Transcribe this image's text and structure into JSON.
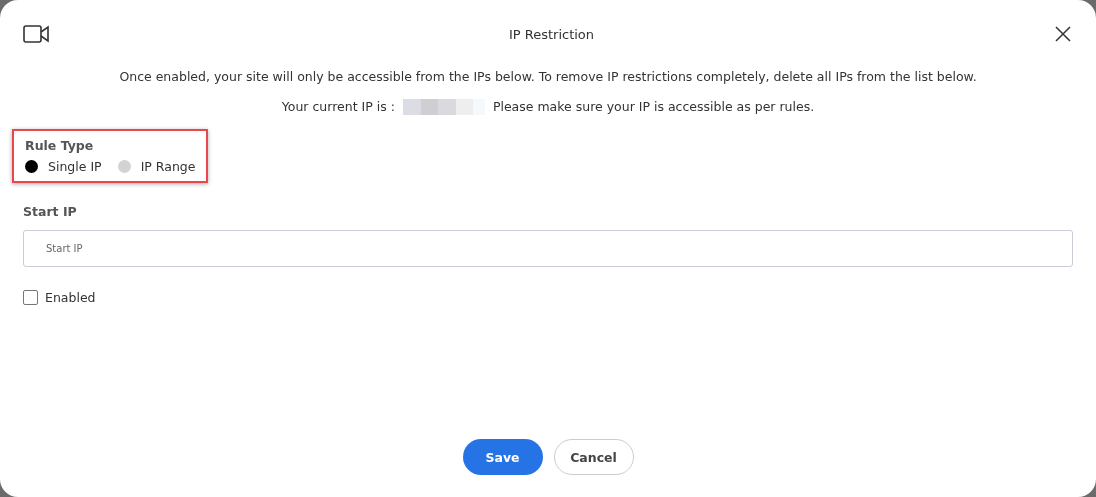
{
  "dialog": {
    "title": "IP Restriction"
  },
  "notice": "Once enabled, your site will only be accessible from the IPs below. To remove IP restrictions completely, delete all IPs from the list below.",
  "current_ip": {
    "label": "Your current IP is :",
    "note": "Please make sure your IP is accessible as per rules."
  },
  "rule_type": {
    "label": "Rule Type",
    "highlighted": true,
    "options": [
      {
        "label": "Single IP",
        "selected": true
      },
      {
        "label": "IP Range",
        "selected": false
      }
    ]
  },
  "start_ip": {
    "label": "Start IP",
    "placeholder": "Start IP"
  },
  "enabled": {
    "label": "Enabled",
    "checked": false
  },
  "buttons": [
    {
      "label": "Save",
      "kind": "primary"
    },
    {
      "label": "Cancel",
      "kind": "secondary"
    }
  ]
}
